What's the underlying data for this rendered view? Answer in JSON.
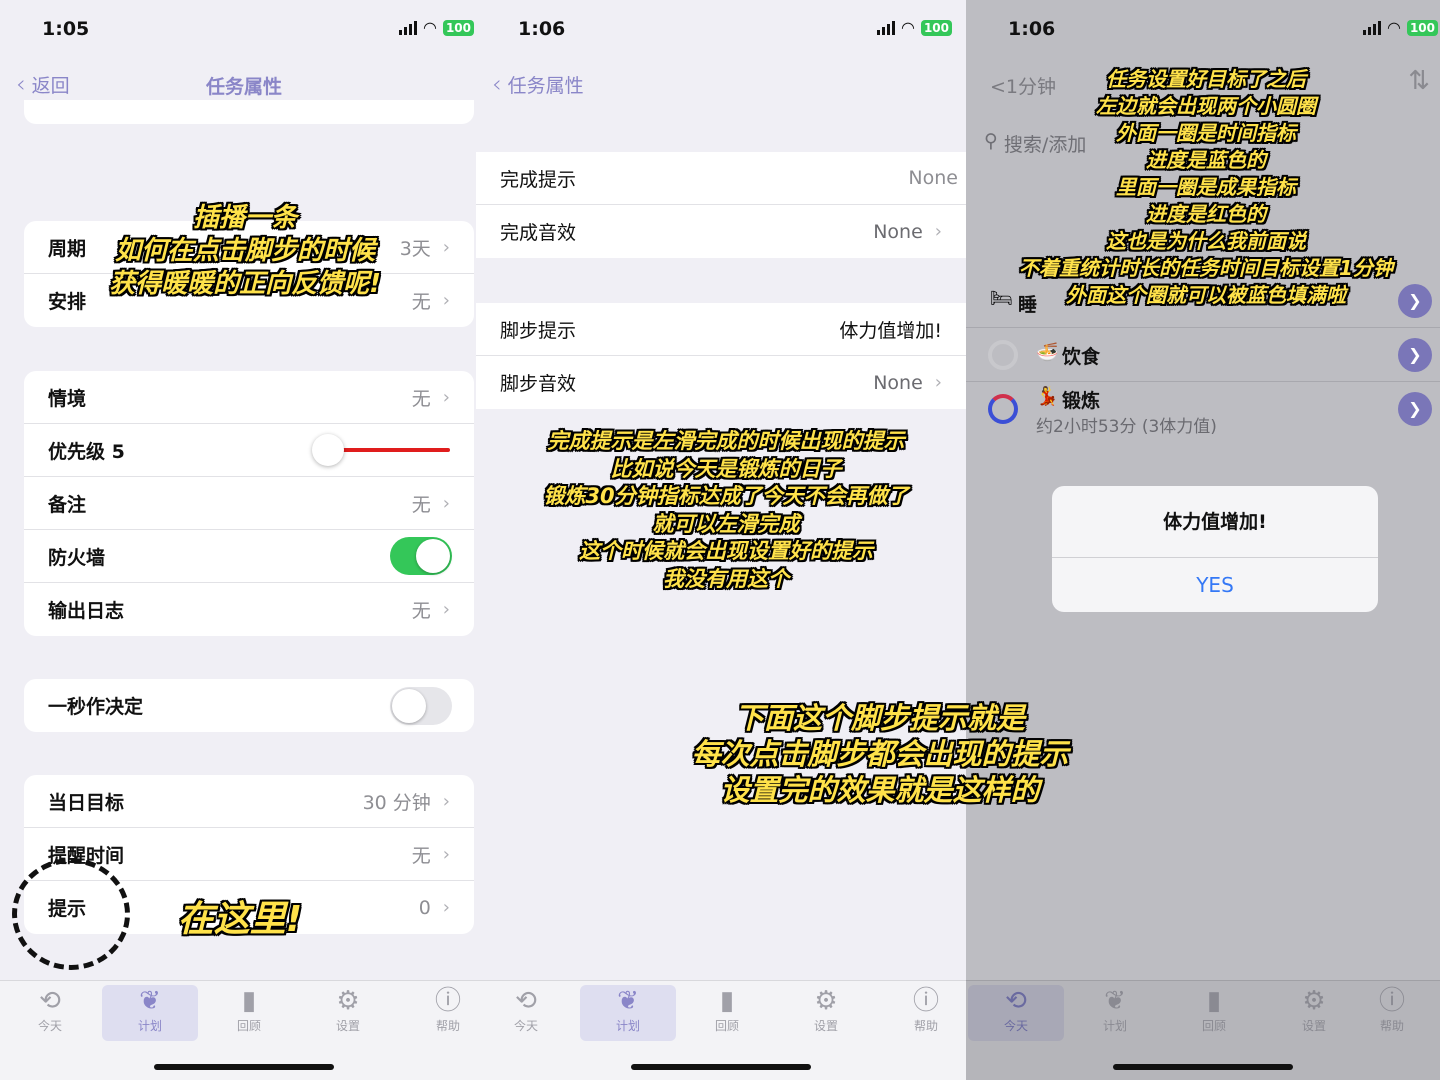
{
  "panel1": {
    "time": "1:05",
    "battery": "100",
    "back_label": "返回",
    "title": "任务属性",
    "group1": [
      {
        "label": "周期",
        "value": "3天"
      },
      {
        "label": "安排",
        "value": "无"
      }
    ],
    "group2": {
      "scene": {
        "label": "情境",
        "value": "无"
      },
      "priority": {
        "label": "优先级 5"
      },
      "note": {
        "label": "备注",
        "value": "无"
      },
      "firewall": {
        "label": "防火墙"
      },
      "log": {
        "label": "输出日志",
        "value": "无"
      }
    },
    "quick": {
      "label": "一秒作决定"
    },
    "group3": [
      {
        "label": "当日目标",
        "value": "30 分钟"
      },
      {
        "label": "提醒时间",
        "value": "无"
      },
      {
        "label": "提示",
        "value": "0"
      }
    ],
    "caption_top": [
      "插播一条",
      "如何在点击脚步的时候",
      "获得暖暖的正向反馈呢!"
    ],
    "caption_here": "在这里!"
  },
  "panel2": {
    "time": "1:06",
    "battery": "100",
    "back_label": "任务属性",
    "group1": [
      {
        "label": "完成提示",
        "value": "None"
      },
      {
        "label": "完成音效",
        "value": "None"
      }
    ],
    "group2": [
      {
        "label": "脚步提示",
        "value": "体力值增加!"
      },
      {
        "label": "脚步音效",
        "value": "None"
      }
    ],
    "caption_mid": [
      "完成提示是左滑完成的时候出现的提示",
      "比如说今天是锻炼的日子",
      "锻炼30分钟指标达成了今天不会再做了",
      "就可以左滑完成",
      "这个时候就会出现设置好的提示",
      "我没有用这个"
    ],
    "caption_bottom": [
      "下面这个脚步提示就是",
      "每次点击脚步都会出现的提示",
      "设置完的效果就是这样的"
    ]
  },
  "panel3": {
    "time": "1:06",
    "battery": "100",
    "nav_left": "<1分钟",
    "search_placeholder": "搜索/添加",
    "items": [
      {
        "icon": "🛏",
        "name": "睡"
      },
      {
        "icon": "🍜",
        "name": "饮食"
      },
      {
        "icon": "💃",
        "name": "锻炼",
        "sub": "约2小时53分 (3体力值)"
      }
    ],
    "dialog": {
      "title": "体力值增加!",
      "button": "YES"
    },
    "caption": [
      "任务设置好目标了之后",
      "左边就会出现两个小圆圈",
      "外面一圈是时间指标",
      "进度是蓝色的",
      "里面一圈是成果指标",
      "进度是红色的",
      "这也是为什么我前面说",
      "不着重统计时长的任务时间目标设置1分钟",
      "外面这个圈就可以被蓝色填满啦"
    ]
  },
  "tabs": [
    "今天",
    "计划",
    "回顾",
    "设置",
    "帮助"
  ],
  "colors": {
    "accent": "#8a86c8",
    "toggle_on": "#34c759",
    "slider": "#e01d1d",
    "caption": "#ffe24a"
  }
}
